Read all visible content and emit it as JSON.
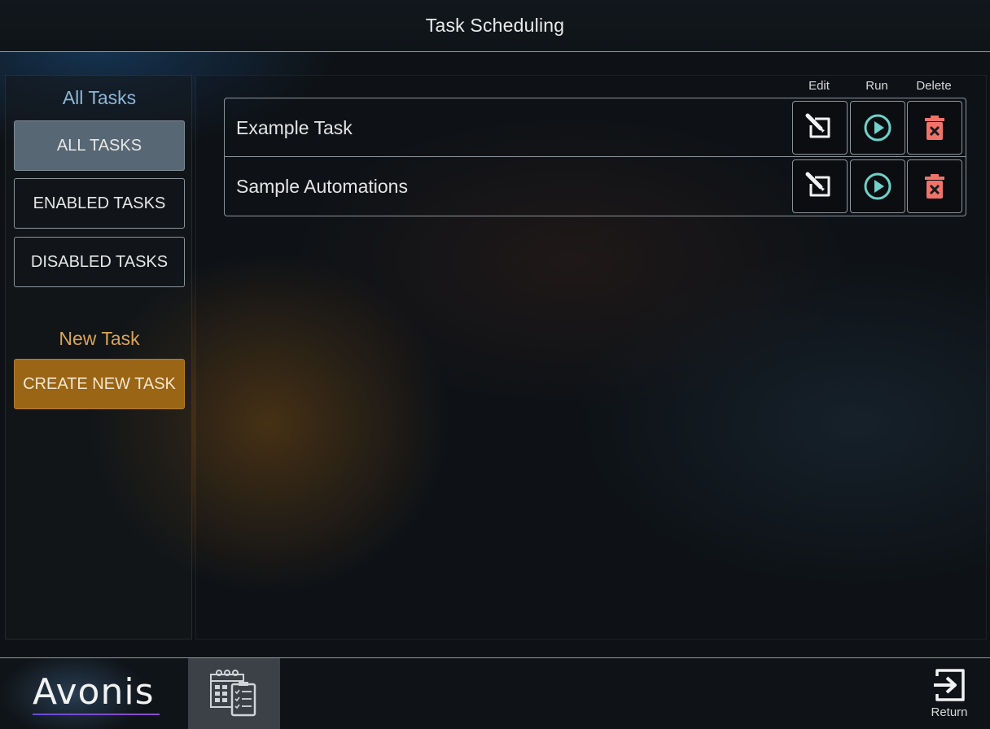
{
  "header": {
    "title": "Task Scheduling"
  },
  "sidebar": {
    "all_tasks_title": "All Tasks",
    "filters": [
      {
        "label": "ALL TASKS",
        "selected": true
      },
      {
        "label": "ENABLED TASKS",
        "selected": false
      },
      {
        "label": "DISABLED TASKS",
        "selected": false
      }
    ],
    "new_task_title": "New Task",
    "create_label": "CREATE NEW TASK"
  },
  "table": {
    "columns": {
      "edit": "Edit",
      "run": "Run",
      "delete": "Delete"
    },
    "tasks": [
      {
        "name": "Example Task"
      },
      {
        "name": "Sample Automations"
      }
    ]
  },
  "footer": {
    "logo_text": "Avonis",
    "return_label": "Return"
  },
  "icons": {
    "edit": "edit-icon",
    "run": "play-circle-icon",
    "delete": "trash-icon",
    "calendar": "calendar-checklist-icon",
    "return": "exit-arrow-icon"
  },
  "colors": {
    "header_title_blue": "#8db7d8",
    "new_task_orange": "#d9a45a",
    "create_button": "#9a6514",
    "selected_filter": "#586774",
    "run_icon": "#6fd1c9",
    "delete_icon": "#f0736b"
  }
}
